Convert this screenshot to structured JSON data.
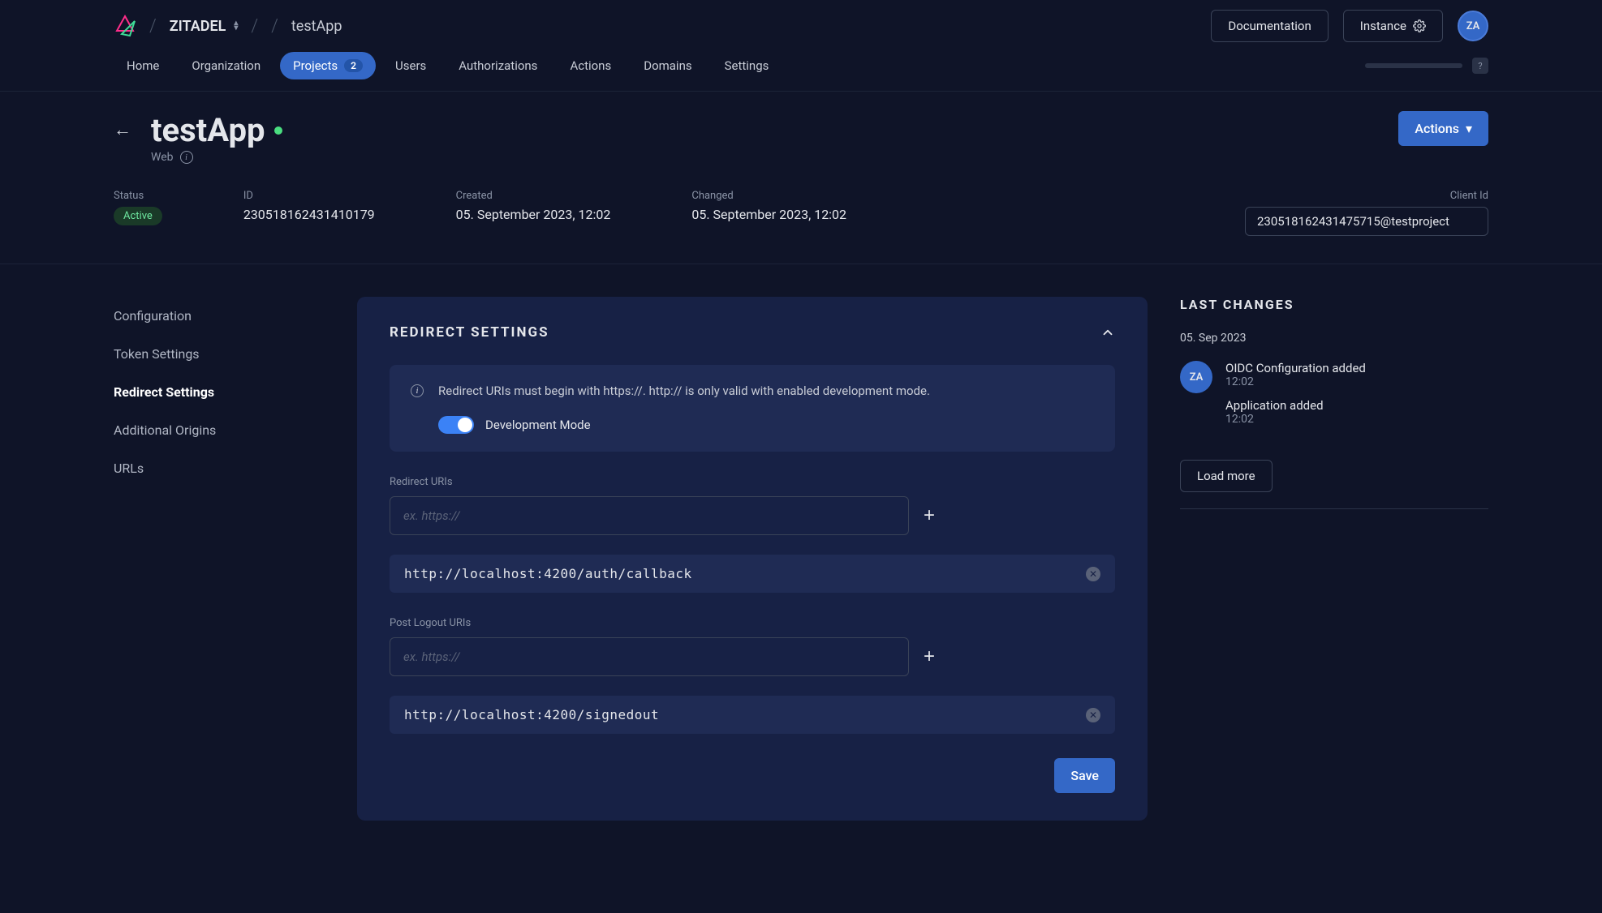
{
  "header": {
    "org": "ZITADEL",
    "app": "testApp",
    "documentation": "Documentation",
    "instance": "Instance",
    "avatar": "ZA"
  },
  "nav": {
    "items": [
      {
        "label": "Home"
      },
      {
        "label": "Organization"
      },
      {
        "label": "Projects",
        "badge": "2"
      },
      {
        "label": "Users"
      },
      {
        "label": "Authorizations"
      },
      {
        "label": "Actions"
      },
      {
        "label": "Domains"
      },
      {
        "label": "Settings"
      }
    ],
    "help": "?"
  },
  "app": {
    "name": "testApp",
    "type": "Web",
    "actions": "Actions"
  },
  "meta": {
    "status_label": "Status",
    "status_value": "Active",
    "id_label": "ID",
    "id_value": "230518162431410179",
    "created_label": "Created",
    "created_value": "05. September 2023, 12:02",
    "changed_label": "Changed",
    "changed_value": "05. September 2023, 12:02",
    "clientid_label": "Client Id",
    "clientid_value": "230518162431475715@testproject"
  },
  "sidenav": [
    "Configuration",
    "Token Settings",
    "Redirect Settings",
    "Additional Origins",
    "URLs"
  ],
  "panel": {
    "title": "REDIRECT SETTINGS",
    "info": "Redirect URIs must begin with https://. http:// is only valid with enabled development mode.",
    "dev_mode": "Development Mode",
    "redirect_label": "Redirect URIs",
    "redirect_placeholder": "ex. https://",
    "redirect_uris": [
      "http://localhost:4200/auth/callback"
    ],
    "logout_label": "Post Logout URIs",
    "logout_placeholder": "ex. https://",
    "logout_uris": [
      "http://localhost:4200/signedout"
    ],
    "save": "Save"
  },
  "changes": {
    "title": "LAST CHANGES",
    "date": "05. Sep 2023",
    "avatar": "ZA",
    "events": [
      {
        "title": "OIDC Configuration added",
        "time": "12:02"
      },
      {
        "title": "Application added",
        "time": "12:02"
      }
    ],
    "load_more": "Load more"
  }
}
